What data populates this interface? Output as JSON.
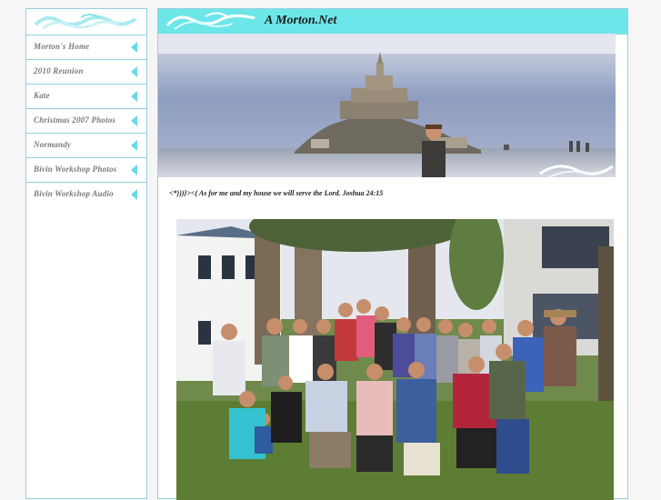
{
  "site": {
    "title": "A Morton.Net"
  },
  "sidebar": {
    "items": [
      {
        "label": "Morton's Home"
      },
      {
        "label": "2010 Reunion"
      },
      {
        "label": "Kate"
      },
      {
        "label": "Christmas 2007 Photos"
      },
      {
        "label": "Normandy"
      },
      {
        "label": "Bivin Workshop Photos"
      },
      {
        "label": "Bivin Workshop Audio"
      }
    ]
  },
  "main": {
    "scripture": "<*)))}><( As for me and my house we will serve the Lord. Joshua 24:15"
  },
  "colors": {
    "accent": "#6de6ea",
    "border": "#98cfe0",
    "arrow": "#66d9e8",
    "nav_text": "#7a7a7a"
  }
}
